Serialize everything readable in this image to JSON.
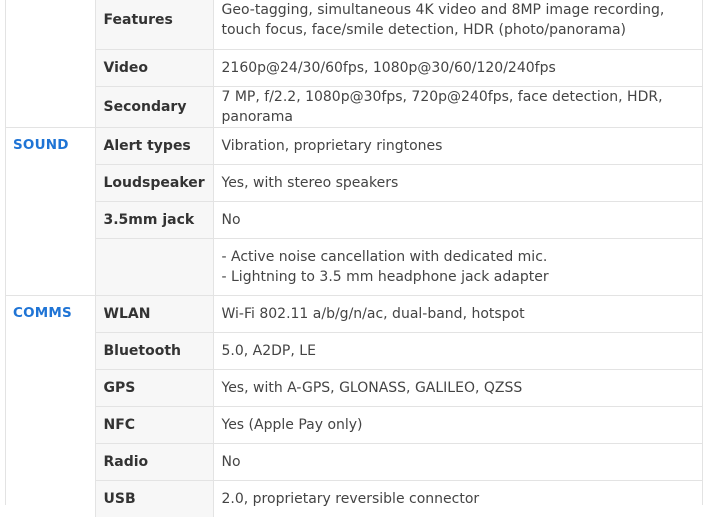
{
  "camera": {
    "rows": [
      {
        "label": "Features",
        "value": "Geo-tagging, simultaneous 4K video and 8MP image recording, touch focus, face/smile detection, HDR (photo/panorama)"
      },
      {
        "label": "Video",
        "value": "2160p@24/30/60fps, 1080p@30/60/120/240fps"
      },
      {
        "label": "Secondary",
        "value": "7 MP, f/2.2, 1080p@30fps, 720p@240fps, face detection, HDR, panorama"
      }
    ]
  },
  "sound": {
    "category": "SOUND",
    "rows": [
      {
        "label": "Alert types",
        "value": "Vibration, proprietary ringtones"
      },
      {
        "label": "Loudspeaker",
        "value": "Yes, with stereo speakers"
      },
      {
        "label": "3.5mm jack",
        "value": "No"
      }
    ],
    "extra_lines": [
      "- Active noise cancellation with dedicated mic.",
      "- Lightning to 3.5 mm headphone jack adapter"
    ]
  },
  "comms": {
    "category": "COMMS",
    "rows": [
      {
        "label": "WLAN",
        "value": "Wi-Fi 802.11 a/b/g/n/ac, dual-band, hotspot"
      },
      {
        "label": "Bluetooth",
        "value": "5.0, A2DP, LE"
      },
      {
        "label": "GPS",
        "value": "Yes, with A-GPS, GLONASS, GALILEO, QZSS"
      },
      {
        "label": "NFC",
        "value": "Yes (Apple Pay only)"
      },
      {
        "label": "Radio",
        "value": "No"
      },
      {
        "label": "USB",
        "value": "2.0, proprietary reversible connector"
      }
    ]
  }
}
